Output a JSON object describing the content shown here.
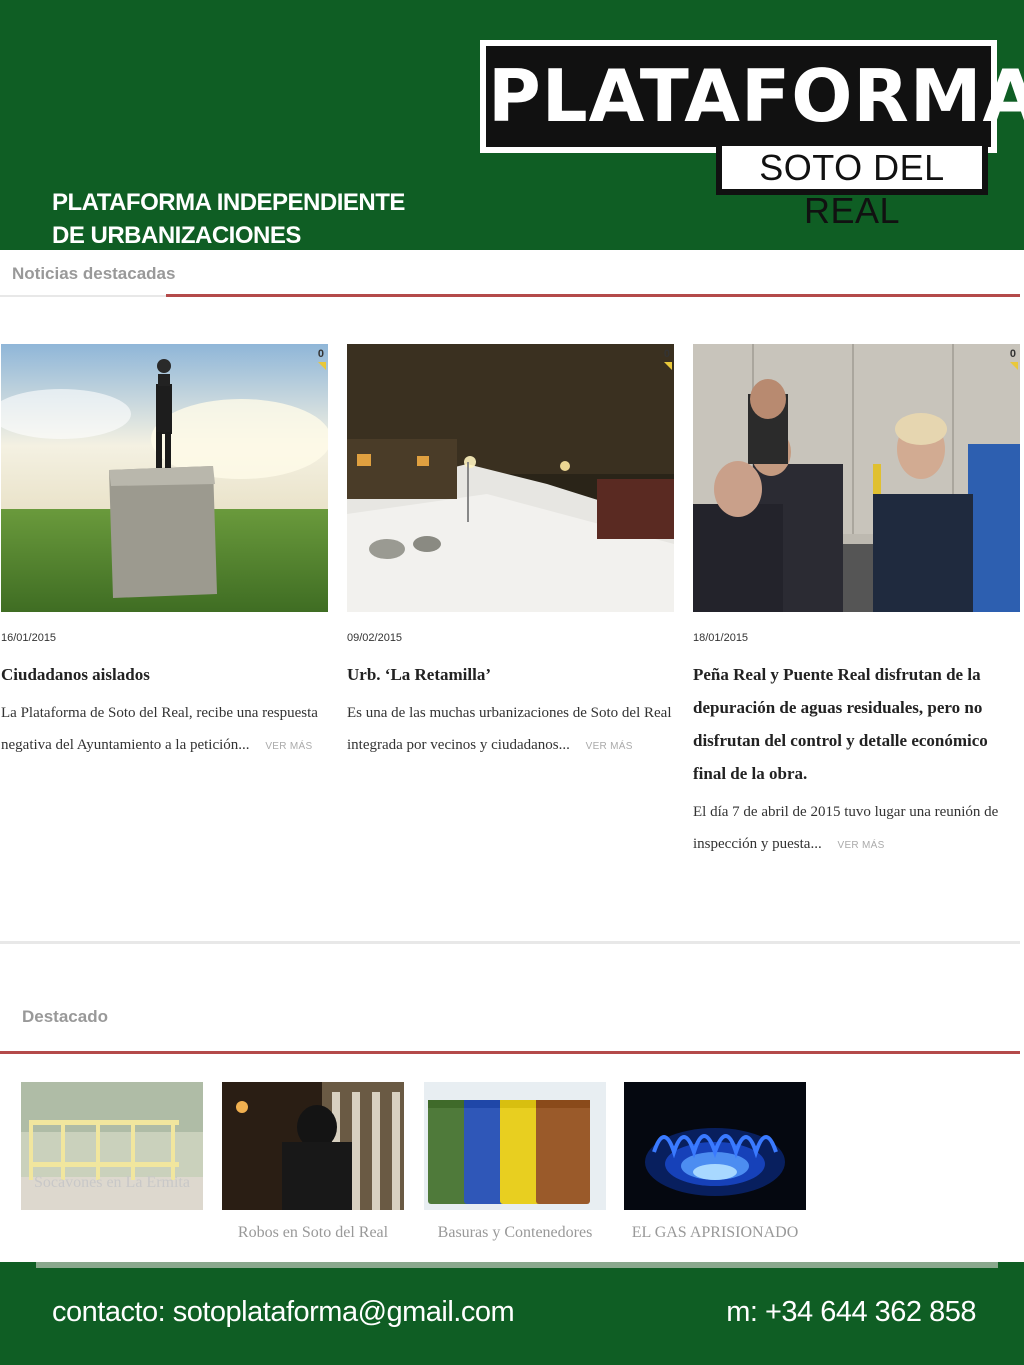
{
  "header": {
    "logo_title": "PLATAFORMA",
    "logo_subtitle": "SOTO DEL REAL",
    "subtitle_line1": "PLATAFORMA INDEPENDIENTE",
    "subtitle_line2": "DE URBANIZACIONES",
    "background_color": "#0f5e24"
  },
  "news_section": {
    "title": "Noticias destacadas",
    "accent_color": "#b44a4a",
    "articles": [
      {
        "comments": "0",
        "date": "16/01/2015",
        "title": "Ciudadanos aislados",
        "excerpt": "La Plataforma de Soto del Real, recibe una respuesta negativa del Ayuntamiento a la petición...",
        "more": "VER MÁS"
      },
      {
        "comments": "0",
        "date": "09/02/2015",
        "title": "Urb. ‘La Retamilla’",
        "excerpt": "Es una de las muchas urbanizaciones de Soto del Real integrada por vecinos y ciudadanos...",
        "more": "VER MÁS"
      },
      {
        "comments": "0",
        "date": "18/01/2015",
        "title": "Peña Real y Puente Real disfrutan de la depuración de aguas residuales, pero no disfrutan del control y detalle económico final de la obra.",
        "excerpt": "El día 7 de abril de 2015 tuvo lugar una reunión de inspección y puesta...",
        "more": "VER MÁS"
      }
    ]
  },
  "featured_section": {
    "title": "Destacado",
    "items": [
      {
        "label": "Socavones en La Ermita"
      },
      {
        "label": "Robos en Soto del Real"
      },
      {
        "label": "Basuras y Contenedores"
      },
      {
        "label": "EL GAS APRISIONADO"
      }
    ]
  },
  "footer": {
    "contact": "contacto:  sotoplataforma@gmail.com",
    "phone": "m: +34 644 362 858"
  }
}
